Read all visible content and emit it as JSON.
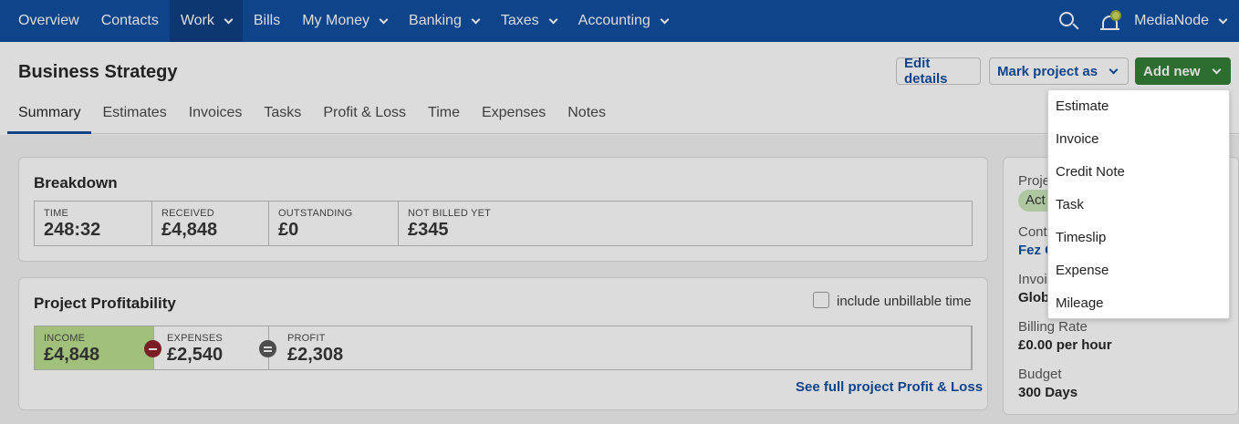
{
  "nav": {
    "items": [
      {
        "label": "Overview",
        "chevron": false
      },
      {
        "label": "Contacts",
        "chevron": false
      },
      {
        "label": "Work",
        "chevron": true,
        "active": true
      },
      {
        "label": "Bills",
        "chevron": false
      },
      {
        "label": "My Money",
        "chevron": true
      },
      {
        "label": "Banking",
        "chevron": true
      },
      {
        "label": "Taxes",
        "chevron": true
      },
      {
        "label": "Accounting",
        "chevron": true
      }
    ],
    "account_name": "MediaNode",
    "notification_dot_color": "#c7d85a"
  },
  "header": {
    "title": "Business Strategy",
    "edit_label": "Edit details",
    "mark_label": "Mark project as",
    "add_label": "Add new"
  },
  "tabs": [
    "Summary",
    "Estimates",
    "Invoices",
    "Tasks",
    "Profit & Loss",
    "Time",
    "Expenses",
    "Notes"
  ],
  "breakdown": {
    "title": "Breakdown",
    "stats": [
      {
        "label": "TIME",
        "value": "248:32"
      },
      {
        "label": "RECEIVED",
        "value": "£4,848"
      },
      {
        "label": "OUTSTANDING",
        "value": "£0"
      },
      {
        "label": "NOT BILLED YET",
        "value": "£345"
      }
    ]
  },
  "profitability": {
    "title": "Project Profitability",
    "checkbox_label": "include unbillable time",
    "income": {
      "label": "INCOME",
      "value": "£4,848"
    },
    "expenses": {
      "label": "EXPENSES",
      "value": "£2,540"
    },
    "profit": {
      "label": "PROFIT",
      "value": "£2,308"
    },
    "link": "See full project Profit & Loss"
  },
  "sidebar": {
    "status_label": "Proje",
    "status_value": "Act",
    "contact_label": "Cont",
    "contact_value": "Fez C",
    "invoice_label": "Invoi",
    "invoice_value": "Glob",
    "billing_rate_label": "Billing Rate",
    "billing_rate_value": "£0.00 per hour",
    "budget_label": "Budget",
    "budget_value": "300 Days"
  },
  "dropdown": {
    "items": [
      "Estimate",
      "Invoice",
      "Credit Note",
      "Task",
      "Timeslip",
      "Expense",
      "Mileage"
    ],
    "highlighted": "Timeslip"
  },
  "colors": {
    "nav_bg": "#0a4a9e",
    "primary_link": "#0a4a9e",
    "add_button": "#2e7d32",
    "income_bg": "#b9de8d",
    "minus_icon": "#8b1c25"
  }
}
